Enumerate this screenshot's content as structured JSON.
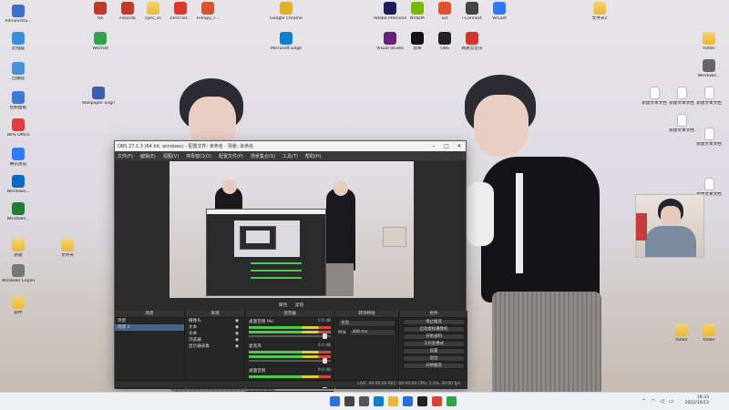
{
  "desktop": {
    "icons": [
      {
        "label": "Administra...",
        "kind": "app",
        "color": "#3b6fc9"
      },
      {
        "label": "此电脑",
        "kind": "app",
        "color": "#3a8ee0"
      },
      {
        "label": "回收站",
        "kind": "app",
        "color": "#4a90d9"
      },
      {
        "label": "控制面板",
        "kind": "app",
        "color": "#3a7bd5"
      },
      {
        "label": "WPS Office",
        "kind": "app",
        "color": "#e23c3c"
      },
      {
        "label": "腾讯会议",
        "kind": "app",
        "color": "#2e7cf6"
      },
      {
        "label": "Windows...",
        "kind": "app",
        "color": "#0b6abf"
      },
      {
        "label": "Windows...",
        "kind": "app",
        "color": "#1e7e34"
      },
      {
        "label": "文件夹",
        "kind": "folder",
        "color": "#f0c24a"
      },
      {
        "label": "新建",
        "kind": "folder",
        "color": "#f0c24a"
      },
      {
        "label": "Windows Explorer",
        "kind": "app",
        "color": "#777"
      },
      {
        "label": "软件",
        "kind": "folder",
        "color": "#f0c24a"
      },
      {
        "label": "64",
        "kind": "app",
        "color": "#c0392b"
      },
      {
        "label": "FileZilla",
        "kind": "app",
        "color": "#c0392b"
      },
      {
        "label": "sync_ss",
        "kind": "folder",
        "color": "#f0c24a"
      },
      {
        "label": "ZeroTier...",
        "kind": "app",
        "color": "#d83b2c"
      },
      {
        "label": "FileSpy_r...",
        "kind": "app",
        "color": "#d8542c"
      },
      {
        "label": "Wechat",
        "kind": "app",
        "color": "#2ea44f"
      },
      {
        "label": "Microsoft Edge",
        "kind": "app",
        "color": "#0c7fd1"
      },
      {
        "label": "Google Chrome",
        "kind": "app",
        "color": "#e0b12c"
      },
      {
        "label": "NVIDIA",
        "kind": "app",
        "color": "#76b900"
      },
      {
        "label": "Visual Studio",
        "kind": "app",
        "color": "#68217a"
      },
      {
        "label": "Adobe Premiere",
        "kind": "app",
        "color": "#1f1d57"
      },
      {
        "label": "剪映",
        "kind": "app",
        "color": "#111"
      },
      {
        "label": "OBS",
        "kind": "app",
        "color": "#222"
      },
      {
        "label": "VeCast",
        "kind": "app",
        "color": "#3478f6"
      },
      {
        "label": "网易云音乐",
        "kind": "app",
        "color": "#d4352a"
      },
      {
        "label": "i-Connect",
        "kind": "app",
        "color": "#444"
      },
      {
        "label": "Git",
        "kind": "app",
        "color": "#e0522b"
      },
      {
        "label": "Wallpaper Engine",
        "kind": "app",
        "color": "#3b5db0"
      },
      {
        "label": "文件夹2",
        "kind": "folder",
        "color": "#f0c24a"
      }
    ],
    "right_icons": [
      {
        "label": "folder",
        "kind": "folder"
      },
      {
        "label": "Windows...",
        "kind": "app"
      },
      {
        "label": "新建文本文档",
        "kind": "doc"
      },
      {
        "label": "新建文本文档",
        "kind": "doc"
      },
      {
        "label": "新建文本文档",
        "kind": "doc"
      },
      {
        "label": "新建文本文档",
        "kind": "doc"
      },
      {
        "label": "新建文本文档",
        "kind": "doc"
      },
      {
        "label": "新建文本文档",
        "kind": "doc"
      },
      {
        "label": "folder",
        "kind": "folder"
      },
      {
        "label": "folder",
        "kind": "folder"
      }
    ]
  },
  "obs": {
    "title": "OBS 27.1.3 (64 bit, windows) - 配置文件: 未命名 - 场景: 未命名",
    "menu": [
      "文件(F)",
      "编辑(E)",
      "视图(V)",
      "停靠窗口(D)",
      "配置文件(P)",
      "场景集合(S)",
      "工具(T)",
      "帮助(H)"
    ],
    "toolbar": [
      "属性",
      "滤镜"
    ],
    "scenes_header": "场景",
    "scenes": [
      "场景",
      "场景 2"
    ],
    "sources_header": "来源",
    "sources": [
      "摄像头",
      "文本",
      "文本",
      "浏览器",
      "显示器采集"
    ],
    "mixer_header": "混音器",
    "mixer": [
      {
        "name": "桌面音频 Mic",
        "db": "0.0 dB",
        "knob": 0.9
      },
      {
        "name": "麦克风",
        "db": "0.0 dB",
        "knob": 0.9
      },
      {
        "name": "桌面音频",
        "db": "0.0 dB",
        "knob": 0.9
      }
    ],
    "transitions_header": "转场特效",
    "transition_value": "淡出",
    "duration_label": "时长",
    "duration_value": "300 ms",
    "controls_header": "控件",
    "controls": [
      "停止推流",
      "启动虚拟摄像机",
      "开始录制",
      "工作室模式",
      "设置",
      "退出",
      "开始推流"
    ],
    "status": "LIVE: 00:00:00   REC: 00:00:00   CPU: 2.1%, 30.00 fps"
  },
  "taskbar": {
    "time": "19:33",
    "date": "2022/10/12",
    "apps": [
      "start",
      "search",
      "taskview",
      "edge",
      "explorer",
      "store",
      "obs",
      "chrome",
      "wechat"
    ]
  }
}
